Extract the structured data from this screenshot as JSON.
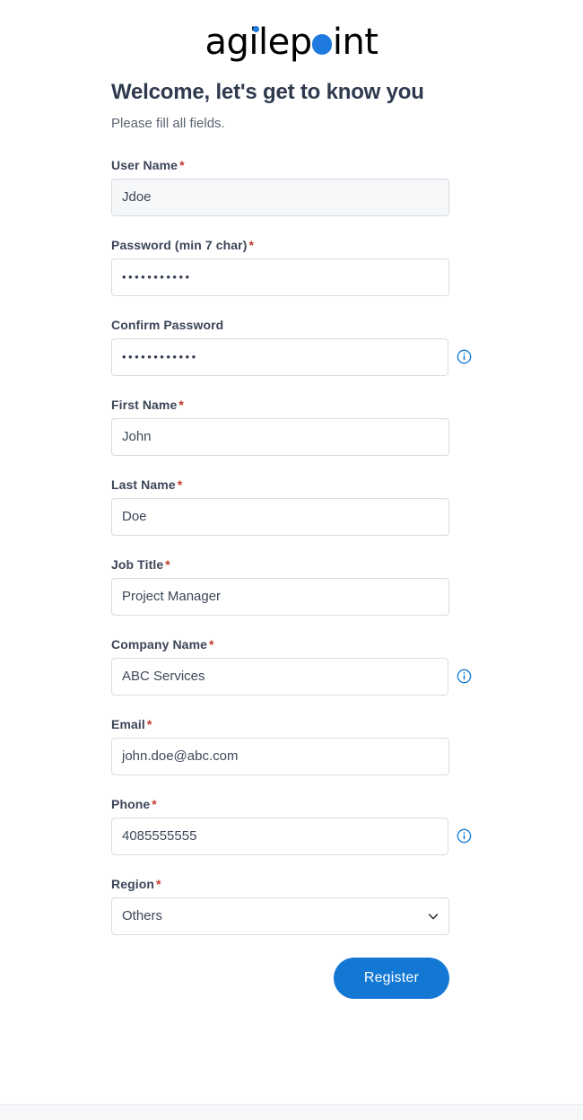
{
  "brand": {
    "logo_text_part1": "agilep",
    "logo_text_part2": "int",
    "logo_name": "agilepoint",
    "accent_color": "#1f7ae0"
  },
  "header": {
    "headline": "Welcome, let's get to know you",
    "subhead": "Please fill all fields."
  },
  "form": {
    "required_marker": "*",
    "fields": [
      {
        "label": "User Name",
        "required": true,
        "value": "Jdoe",
        "placeholder": "",
        "type": "text",
        "filled": true,
        "info": false
      },
      {
        "label": "Password (min 7 char)",
        "required": true,
        "value": "•••••••••••",
        "placeholder": "",
        "type": "password",
        "filled": false,
        "info": false
      },
      {
        "label": "Confirm Password",
        "required": false,
        "value": "••••••••••••",
        "placeholder": "",
        "type": "password",
        "filled": false,
        "info": true
      },
      {
        "label": "First Name",
        "required": true,
        "value": "John",
        "placeholder": "",
        "type": "text",
        "filled": false,
        "info": false
      },
      {
        "label": "Last Name",
        "required": true,
        "value": "Doe",
        "placeholder": "",
        "type": "text",
        "filled": false,
        "info": false
      },
      {
        "label": "Job Title",
        "required": true,
        "value": "Project Manager",
        "placeholder": "",
        "type": "text",
        "filled": false,
        "info": false
      },
      {
        "label": "Company Name",
        "required": true,
        "value": "ABC Services",
        "placeholder": "",
        "type": "text",
        "filled": false,
        "info": true
      },
      {
        "label": "Email",
        "required": true,
        "value": "john.doe@abc.com",
        "placeholder": "",
        "type": "email",
        "filled": false,
        "info": false
      },
      {
        "label": "Phone",
        "required": true,
        "value": "4085555555",
        "placeholder": "",
        "type": "tel",
        "filled": false,
        "info": true
      },
      {
        "label": "Region",
        "required": true,
        "value": "Others",
        "placeholder": "",
        "type": "select",
        "filled": false,
        "info": false,
        "options": [
          "Others"
        ]
      }
    ]
  },
  "actions": {
    "register_label": "Register",
    "register_color": "#1378d4"
  }
}
